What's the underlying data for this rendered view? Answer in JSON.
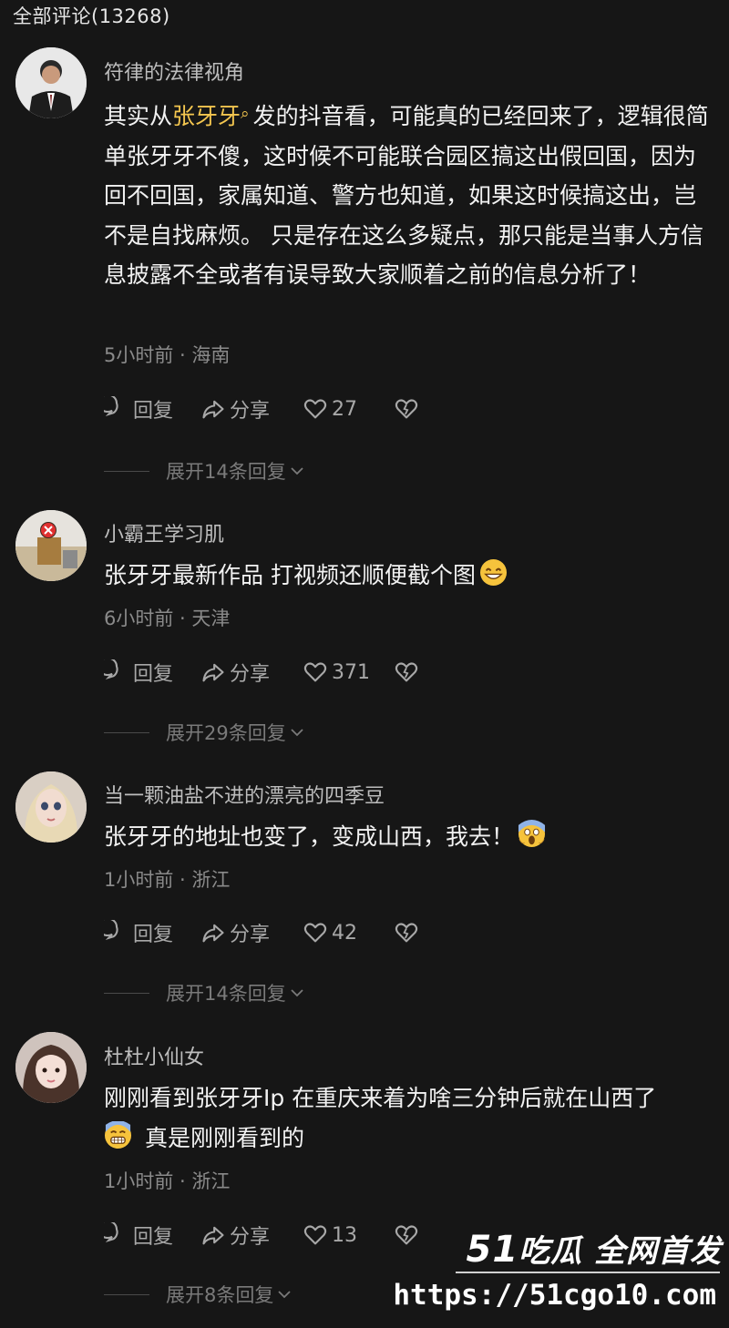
{
  "header": {
    "title": "全部评论(13268)"
  },
  "comments": [
    {
      "author": "符律的法律视角",
      "text_before": "其实从",
      "mention": "张牙牙",
      "text_after": "发的抖音看，可能真的已经回来了，逻辑很简单张牙牙不傻，这时候不可能联合园区搞这出假回国，因为回不回国，家属知道、警方也知道，如果这时候搞这出，岂不是自找麻烦。 只是存在这么多疑点，那只能是当事人方信息披露不全或者有误导致大家顺着之前的信息分析了！",
      "meta": "5小时前 · 海南",
      "reply_label": "回复",
      "share_label": "分享",
      "likes": "27",
      "expand": "展开14条回复"
    },
    {
      "author": "小霸王学习肌",
      "text": "张牙牙最新作品 打视频还顺便截个图",
      "emoji": "grinning-face-emoji",
      "meta": "6小时前 · 天津",
      "reply_label": "回复",
      "share_label": "分享",
      "likes": "371",
      "expand": "展开29条回复"
    },
    {
      "author": "当一颗油盐不进的漂亮的四季豆",
      "text": "张牙牙的地址也变了，变成山西，我去！",
      "emoji": "screaming-face-emoji",
      "meta": "1小时前 · 浙江",
      "reply_label": "回复",
      "share_label": "分享",
      "likes": "42",
      "expand": "展开14条回复"
    },
    {
      "author": "杜杜小仙女",
      "text": "刚刚看到张牙牙Ip 在重庆来着为啥三分钟后就在山西了",
      "emoji": "grimacing-face-emoji",
      "text_after_emoji": "真是刚刚看到的",
      "meta": "1小时前 · 浙江",
      "reply_label": "回复",
      "share_label": "分享",
      "likes": "13",
      "expand": "展开8条回复"
    }
  ],
  "watermark": {
    "logo_number": "51",
    "logo_text": "吃瓜 全网首发",
    "url": "https://51cgo10.com"
  },
  "colors": {
    "background": "#161616",
    "mention": "#f4c64f",
    "secondary_text": "#8a8a8a"
  }
}
